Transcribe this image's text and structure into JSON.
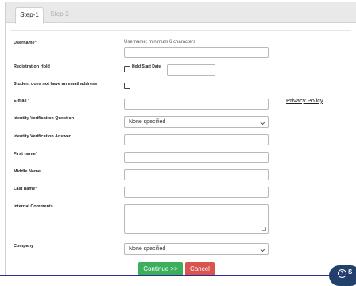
{
  "tabs": [
    {
      "label": "Step-1",
      "active": true
    },
    {
      "label": "Step-2",
      "active": false
    }
  ],
  "form": {
    "username": {
      "label": "Username",
      "hint": "Username: minimum 6 characters",
      "value": ""
    },
    "registration_hold": {
      "label": "Registration Hold",
      "checkbox_label": "Hold Start Date",
      "checked": false,
      "date_value": ""
    },
    "no_email": {
      "label": "Student does not have an email address",
      "checked": false
    },
    "email": {
      "label": "E-mail",
      "value": ""
    },
    "privacy_policy": "Privacy Policy",
    "verification_question": {
      "label": "Identity Verification Question",
      "selected": "None specified"
    },
    "verification_answer": {
      "label": "Identity Verification Answer",
      "value": ""
    },
    "first_name": {
      "label": "First name",
      "value": ""
    },
    "middle_name": {
      "label": "Middle Name",
      "value": ""
    },
    "last_name": {
      "label": "Last name",
      "value": ""
    },
    "internal_comments": {
      "label": "Internal Comments",
      "value": ""
    },
    "company": {
      "label": "Company",
      "selected": "None specified"
    }
  },
  "buttons": {
    "continue": "Continue >>",
    "cancel": "Cancel"
  },
  "help": {
    "icon_glyph": "?",
    "label": "S"
  },
  "required_marker": "*",
  "colors": {
    "required": "#c0392b",
    "continue": "#3caf5c",
    "cancel": "#d9534f",
    "help": "#21416b"
  }
}
